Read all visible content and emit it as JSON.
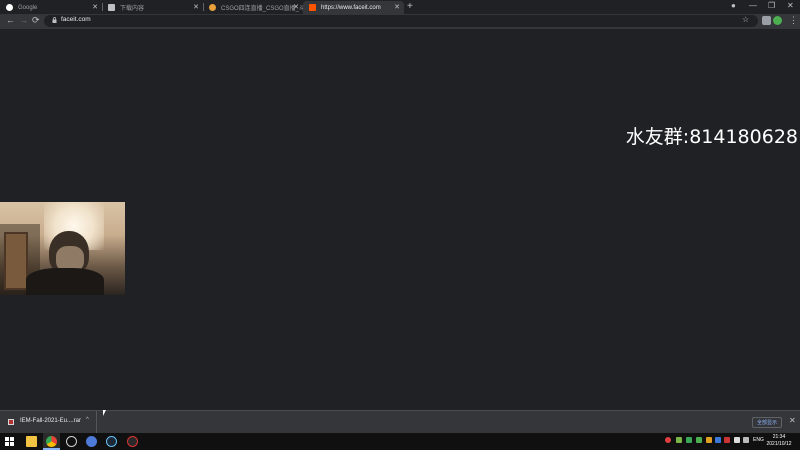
{
  "browser": {
    "tabs": [
      {
        "title": "Google",
        "active": false
      },
      {
        "title": "下载内容",
        "active": false
      },
      {
        "title": "CSGO四连直播_CSGO直播_斗鱼",
        "active": false
      },
      {
        "title": "https://www.faceit.com",
        "active": true
      }
    ],
    "new_tab_label": "+",
    "window_controls": {
      "minimize": "—",
      "restore": "❐",
      "close": "✕"
    },
    "nav": {
      "back": "←",
      "forward": "→",
      "reload": "⟳"
    },
    "address": "faceit.com",
    "star_icon": "☆",
    "menu_icon": "⋮"
  },
  "page": {
    "banner": "水友群:814180628"
  },
  "downloads": {
    "file_name": "IEM-Fall-2021-Eu....rar",
    "show_all": "全部显示",
    "chevron": "^",
    "close": "✕"
  },
  "taskbar": {
    "lang": "ENG",
    "time": "21:34",
    "date": "2021/10/12"
  }
}
